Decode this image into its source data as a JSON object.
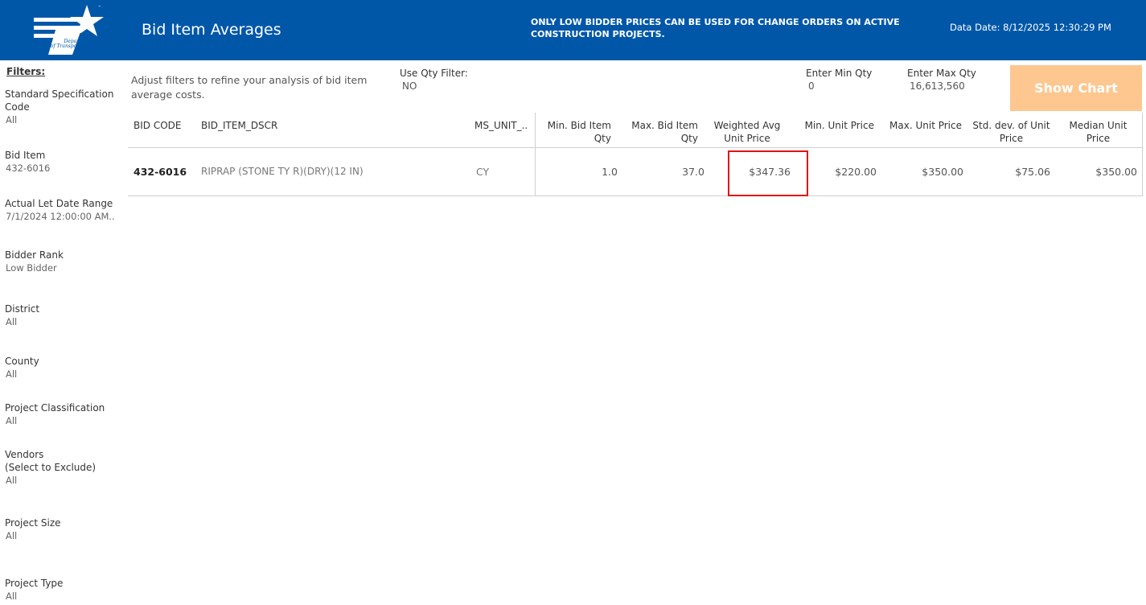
{
  "header": {
    "logo_text": "Texas\nDepartment\nof Transportation",
    "title": "Bid Item Averages",
    "warning": "ONLY LOW BIDDER PRICES CAN BE USED FOR CHANGE ORDERS ON ACTIVE CONSTRUCTION PROJECTS.",
    "data_date": "Data Date: 8/12/2025 12:30:29 PM"
  },
  "sidebar": {
    "heading": "Filters:",
    "filters": [
      {
        "label": "Standard Specification Code",
        "value": "All"
      },
      {
        "label": "Bid Item",
        "value": "432-6016"
      },
      {
        "label": "Actual Let Date Range",
        "value": "7/1/2024 12:00:00 AM.."
      },
      {
        "label": "Bidder Rank",
        "value": "Low Bidder"
      },
      {
        "label": "District",
        "value": "All"
      },
      {
        "label": "County",
        "value": "All"
      },
      {
        "label": "Project Classification",
        "value": "All"
      },
      {
        "label": "Vendors\n(Select to Exclude)",
        "value": "All"
      },
      {
        "label": "Project Size",
        "value": "All"
      },
      {
        "label": "Project Type",
        "value": "All"
      }
    ]
  },
  "controls": {
    "intro": "Adjust filters to refine your analysis of bid item average costs.",
    "qty_filter_label": "Use Qty Filter:",
    "qty_filter_value": "NO",
    "min_qty_label": "Enter Min Qty",
    "min_qty_value": "0",
    "max_qty_label": "Enter Max Qty",
    "max_qty_value": "16,613,560",
    "show_chart": "Show Chart"
  },
  "table": {
    "columns": [
      "BID CODE",
      "BID_ITEM_DSCR",
      "MS_UNIT_..",
      "Min. Bid Item Qty",
      "Max. Bid Item Qty",
      "Weighted Avg Unit Price",
      "Min. Unit Price",
      "Max. Unit Price",
      "Std. dev. of Unit Price",
      "Median Unit Price"
    ],
    "rows": [
      [
        "432-6016",
        "RIPRAP (STONE TY R)(DRY)(12 IN)",
        "CY",
        "1.0",
        "37.0",
        "$347.36",
        "$220.00",
        "$350.00",
        "$75.06",
        "$350.00"
      ]
    ]
  },
  "colors": {
    "header_bg": "#0057a8",
    "button_bg": "#fec78f",
    "highlight": "#e0121a"
  }
}
